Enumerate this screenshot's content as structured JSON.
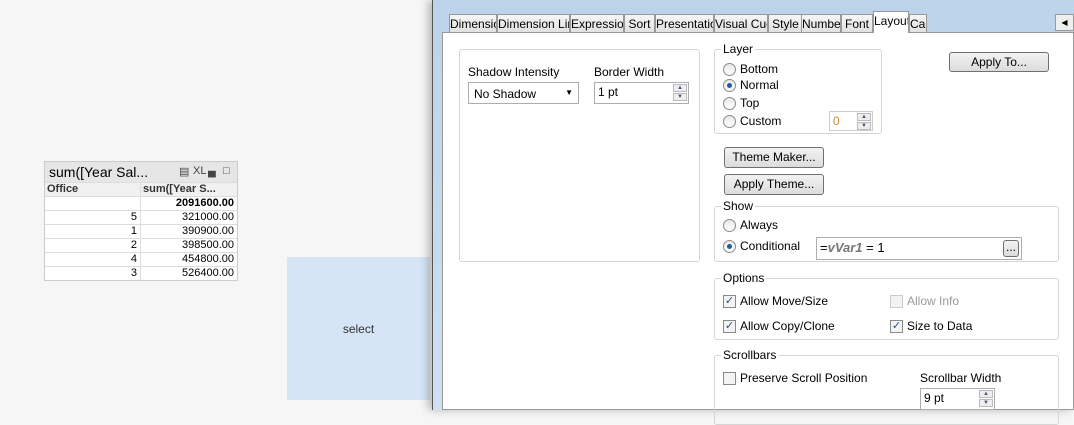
{
  "table": {
    "title": "sum([Year Sal...",
    "icons": [
      "print-icon",
      "xl-icon",
      "minimize-icon",
      "maximize-icon"
    ],
    "xl_label": "XL",
    "headers": [
      "Office",
      "sum([Year S..."
    ],
    "total": "2091600.00",
    "rows": [
      [
        "5",
        "321000.00"
      ],
      [
        "1",
        "390900.00"
      ],
      [
        "2",
        "398500.00"
      ],
      [
        "4",
        "454800.00"
      ],
      [
        "3",
        "526400.00"
      ]
    ]
  },
  "select_box": {
    "label": "select"
  },
  "dialog": {
    "tabs": [
      "Dimensions",
      "Dimension Limits",
      "Expressions",
      "Sort",
      "Presentation",
      "Visual Cues",
      "Style",
      "Number",
      "Font",
      "Layout",
      "Cap"
    ],
    "active_tab": "Layout",
    "shadow_label": "Shadow Intensity",
    "shadow_value": "No Shadow",
    "border_label": "Border Width",
    "border_value": "1 pt",
    "layer": {
      "label": "Layer",
      "options": [
        "Bottom",
        "Normal",
        "Top",
        "Custom"
      ],
      "selected": "Normal",
      "custom_value": "0"
    },
    "apply_to": "Apply To...",
    "theme_maker": "Theme Maker...",
    "apply_theme": "Apply Theme...",
    "show": {
      "label": "Show",
      "always": "Always",
      "conditional": "Conditional",
      "selected": "Conditional",
      "expr_eq": "=",
      "expr_var": "vVar1",
      "expr_rest": " = 1",
      "more": "..."
    },
    "options": {
      "label": "Options",
      "allow_move": "Allow Move/Size",
      "allow_copy": "Allow Copy/Clone",
      "allow_info": "Allow Info",
      "size_to_data": "Size to Data"
    },
    "scrollbars": {
      "label": "Scrollbars",
      "preserve": "Preserve Scroll Position",
      "width_label": "Scrollbar Width",
      "width_value": "9 pt"
    }
  }
}
